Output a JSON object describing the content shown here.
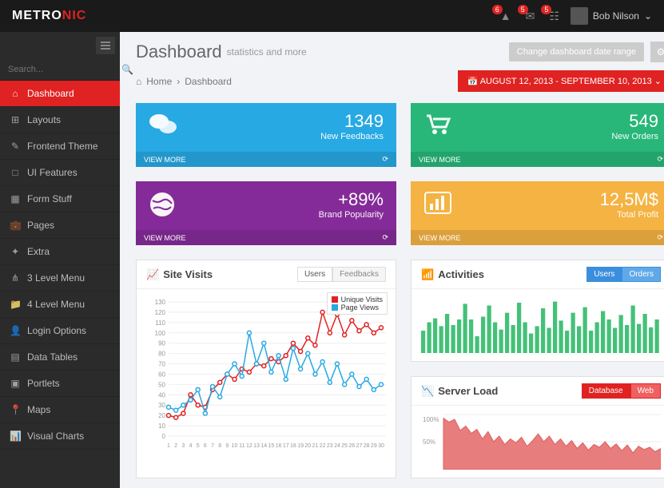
{
  "logo": {
    "p1": "METRO",
    "p2": "NIC"
  },
  "notifs": [
    {
      "badge": "6"
    },
    {
      "badge": "5"
    },
    {
      "badge": "5"
    }
  ],
  "user": {
    "name": "Bob Nilson"
  },
  "search": {
    "placeholder": "Search..."
  },
  "nav": [
    {
      "icon": "⌂",
      "label": "Dashboard",
      "active": true
    },
    {
      "icon": "⊞",
      "label": "Layouts"
    },
    {
      "icon": "✎",
      "label": "Frontend Theme"
    },
    {
      "icon": "□",
      "label": "UI Features"
    },
    {
      "icon": "▦",
      "label": "Form Stuff"
    },
    {
      "icon": "💼",
      "label": "Pages"
    },
    {
      "icon": "✦",
      "label": "Extra"
    },
    {
      "icon": "⋔",
      "label": "3 Level Menu"
    },
    {
      "icon": "📁",
      "label": "4 Level Menu"
    },
    {
      "icon": "👤",
      "label": "Login Options"
    },
    {
      "icon": "▤",
      "label": "Data Tables"
    },
    {
      "icon": "▣",
      "label": "Portlets"
    },
    {
      "icon": "📍",
      "label": "Maps"
    },
    {
      "icon": "📊",
      "label": "Visual Charts"
    }
  ],
  "page": {
    "title": "Dashboard",
    "subtitle": "statistics and more"
  },
  "change_btn": "Change dashboard date range",
  "breadcrumb": {
    "home": "Home",
    "current": "Dashboard"
  },
  "daterange": "AUGUST 12, 2013 - SEPTEMBER 10, 2013",
  "tiles": [
    {
      "value": "1349",
      "label": "New Feedbacks",
      "more": "VIEW MORE",
      "color": "t-blue",
      "icon": "comments"
    },
    {
      "value": "549",
      "label": "New Orders",
      "more": "VIEW MORE",
      "color": "t-green",
      "icon": "cart"
    },
    {
      "value": "+89%",
      "label": "Brand Popularity",
      "more": "VIEW MORE",
      "color": "t-purple",
      "icon": "globe"
    },
    {
      "value": "12,5M$",
      "label": "Total Profit",
      "more": "VIEW MORE",
      "color": "t-yellow",
      "icon": "barchart"
    }
  ],
  "panels": {
    "visits": {
      "title": "Site Visits",
      "tabs": [
        "Users",
        "Feedbacks"
      ],
      "legend": [
        "Unique Visits",
        "Page Views"
      ]
    },
    "activities": {
      "title": "Activities",
      "tabs": [
        "Users",
        "Orders"
      ]
    },
    "serverload": {
      "title": "Server Load",
      "tabs": [
        "Database",
        "Web"
      ],
      "y": [
        "100%",
        "50%"
      ]
    }
  },
  "chart_data": [
    {
      "type": "line",
      "title": "Site Visits",
      "xlabel": "",
      "ylabel": "",
      "ylim": [
        0,
        130
      ],
      "x": [
        1,
        2,
        3,
        4,
        5,
        6,
        7,
        8,
        9,
        10,
        11,
        12,
        13,
        14,
        15,
        16,
        17,
        18,
        19,
        20,
        21,
        22,
        23,
        24,
        25,
        26,
        27,
        28,
        29,
        30
      ],
      "series": [
        {
          "name": "Unique Visits",
          "color": "#e02222",
          "values": [
            20,
            18,
            22,
            40,
            30,
            28,
            45,
            52,
            60,
            55,
            65,
            62,
            70,
            68,
            75,
            72,
            78,
            90,
            82,
            95,
            88,
            120,
            100,
            118,
            98,
            112,
            102,
            108,
            100,
            105
          ]
        },
        {
          "name": "Page Views",
          "color": "#27a9e3",
          "values": [
            28,
            25,
            30,
            35,
            45,
            22,
            48,
            38,
            60,
            70,
            58,
            100,
            70,
            90,
            62,
            78,
            55,
            85,
            65,
            80,
            60,
            72,
            52,
            70,
            50,
            60,
            48,
            55,
            45,
            50
          ]
        }
      ]
    },
    {
      "type": "bar",
      "title": "Activities",
      "color": "#44c178",
      "ylim": [
        0,
        100
      ],
      "values": [
        40,
        55,
        62,
        48,
        70,
        50,
        60,
        88,
        60,
        30,
        65,
        85,
        55,
        42,
        72,
        50,
        90,
        55,
        35,
        48,
        80,
        45,
        92,
        58,
        40,
        72,
        48,
        82,
        40,
        55,
        75,
        60,
        45,
        68,
        50,
        85,
        52,
        70,
        46,
        60
      ]
    },
    {
      "type": "area",
      "title": "Server Load",
      "color": "#e25c5c",
      "ylim": [
        0,
        100
      ],
      "yticks": [
        "100%",
        "50%"
      ],
      "values": [
        92,
        85,
        90,
        70,
        78,
        65,
        72,
        55,
        68,
        50,
        60,
        45,
        55,
        48,
        58,
        42,
        52,
        64,
        50,
        60,
        45,
        55,
        42,
        52,
        38,
        48,
        35,
        45,
        40,
        50,
        38,
        46,
        34,
        44,
        30,
        42,
        36,
        40,
        32,
        38
      ]
    }
  ]
}
